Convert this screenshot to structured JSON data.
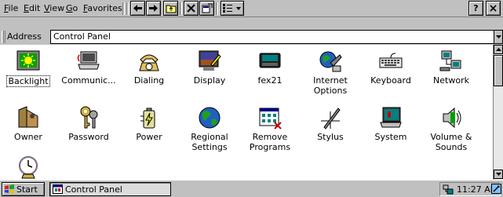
{
  "menu": {
    "file": "File",
    "edit": "Edit",
    "view": "View",
    "go": "Go",
    "favorites": "Favorites"
  },
  "toolbar": {
    "help_label": "?",
    "close_label": "×"
  },
  "address": {
    "label": "Address",
    "value": "Control Panel"
  },
  "items": [
    {
      "label": "Backlight",
      "icon": "backlight-icon",
      "selected": true
    },
    {
      "label": "Communic...",
      "icon": "communications-icon"
    },
    {
      "label": "Dialing",
      "icon": "dialing-icon"
    },
    {
      "label": "Display",
      "icon": "display-icon"
    },
    {
      "label": "fex21",
      "icon": "fex21-icon"
    },
    {
      "label": "Internet\nOptions",
      "icon": "internet-options-icon"
    },
    {
      "label": "Keyboard",
      "icon": "keyboard-icon"
    },
    {
      "label": "Network",
      "icon": "network-icon"
    },
    {
      "label": "Owner",
      "icon": "owner-icon"
    },
    {
      "label": "Password",
      "icon": "password-icon"
    },
    {
      "label": "Power",
      "icon": "power-icon"
    },
    {
      "label": "Regional\nSettings",
      "icon": "regional-settings-icon"
    },
    {
      "label": "Remove\nPrograms",
      "icon": "remove-programs-icon"
    },
    {
      "label": "Stylus",
      "icon": "stylus-icon"
    },
    {
      "label": "System",
      "icon": "system-icon"
    },
    {
      "label": "Volume &\nSounds",
      "icon": "volume-sounds-icon"
    },
    {
      "label": "",
      "icon": "date-time-icon"
    }
  ],
  "taskbar": {
    "start": "Start",
    "task": "Control Panel",
    "time": "11:27 AM"
  },
  "colors": {
    "chrome": "#c0c0c0",
    "pane": "#ffffff",
    "shadow": "#808080"
  }
}
